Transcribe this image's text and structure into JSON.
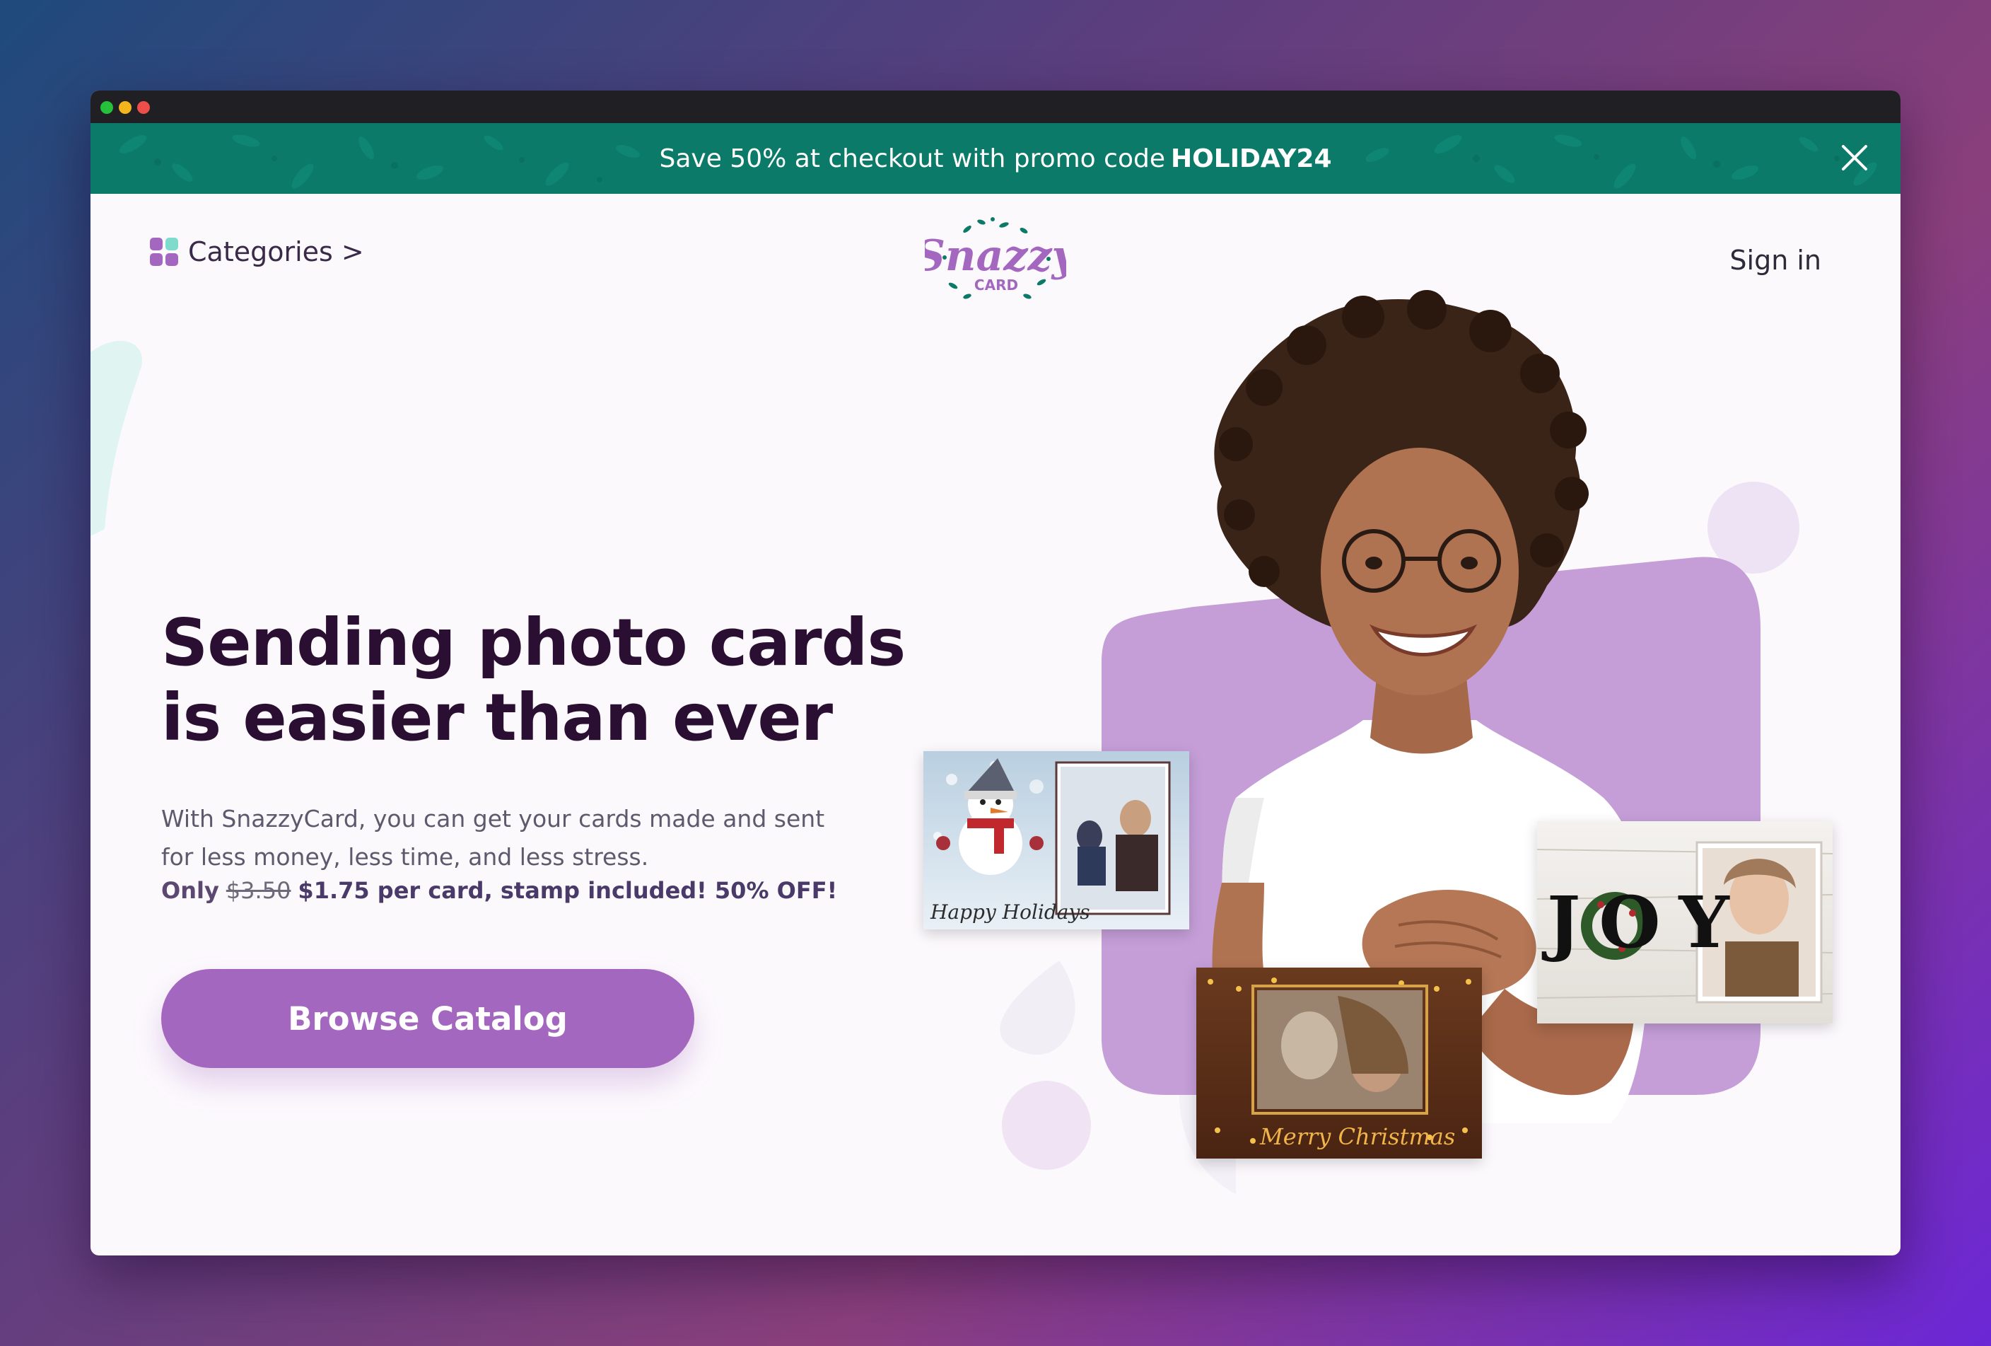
{
  "promo": {
    "message": "Save 50% at checkout with promo code",
    "code": "HOLIDAY24",
    "close_icon": "close-icon"
  },
  "nav": {
    "categories_label": "Categories >",
    "categories_icon": "grid-icon",
    "logo_word": "Snazzy",
    "logo_sub": "CARD",
    "signin_label": "Sign in"
  },
  "hero": {
    "title_line1": "Sending photo cards",
    "title_line2": "is easier than ever",
    "subtitle_line1": "With SnazzyCard, you can get your cards made and sent",
    "subtitle_line2": "for less money, less time, and less stress.",
    "price_only": "Only",
    "price_old": "$3.50",
    "price_new": "$1.75 per card, stamp included! 50% OFF!",
    "cta_label": "Browse Catalog"
  },
  "cards": {
    "card1_text": "Happy Holidays",
    "card2_text": "Merry Christmas",
    "card3_text": "JOY"
  },
  "colors": {
    "promo_bg": "#0c7a69",
    "accent": "#a467c0",
    "title": "#2a0f33",
    "body_text": "#5e5a6e",
    "window_bg": "#fcf9fd"
  }
}
